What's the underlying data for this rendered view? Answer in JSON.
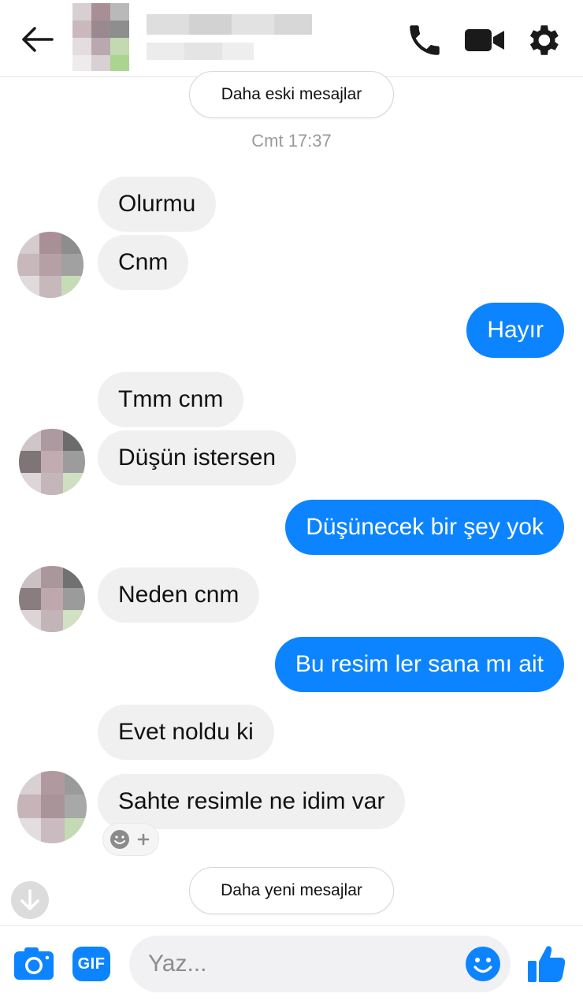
{
  "header": {
    "back_icon": "arrow-left-icon",
    "call_icon": "phone-icon",
    "video_icon": "video-camera-icon",
    "settings_icon": "gear-icon",
    "accent_color": "#1a1a1a"
  },
  "conversation": {
    "older_messages_label": "Daha eski mesajlar",
    "newer_messages_label": "Daha yeni mesajlar",
    "timestamp": "Cmt 17:37",
    "messages": [
      {
        "direction": "in",
        "text": "Olurmu"
      },
      {
        "direction": "in",
        "text": "Cnm"
      },
      {
        "direction": "out",
        "text": "Hayır"
      },
      {
        "direction": "in",
        "text": "Tmm cnm"
      },
      {
        "direction": "in",
        "text": "Düşün istersen"
      },
      {
        "direction": "out",
        "text": "Düşünecek bir şey yok"
      },
      {
        "direction": "in",
        "text": "Neden cnm"
      },
      {
        "direction": "out",
        "text": "Bu resim ler sana mı ait"
      },
      {
        "direction": "in",
        "text": "Evet noldu ki"
      },
      {
        "direction": "in",
        "text": "Sahte resimle ne idim var"
      }
    ],
    "reaction_button_icon": "smiley-plus-icon",
    "scroll_down_icon": "arrow-down-icon"
  },
  "composer": {
    "camera_icon": "camera-icon",
    "gif_label": "GIF",
    "placeholder": "Yaz...",
    "emoji_icon": "smiley-icon",
    "like_icon": "thumbs-up-icon",
    "accent_color": "#0d84ff"
  }
}
